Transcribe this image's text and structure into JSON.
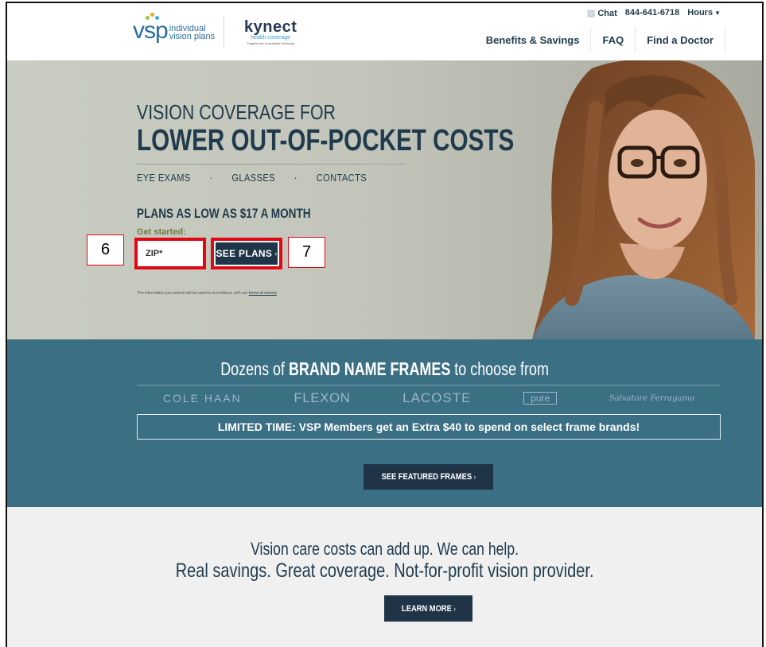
{
  "header": {
    "logo_vsp_text": "vsp",
    "logo_vsp_line1": "individual",
    "logo_vsp_line2": "vision plans",
    "logo_kynect_main": "kynect",
    "logo_kynect_sub": "health coverage",
    "logo_kynect_tagline": "Together for a Healthier Kentucky",
    "util": {
      "chat_label": "Chat",
      "phone": "844-641-6718",
      "hours_label": "Hours"
    },
    "nav": [
      {
        "label": "Benefits & Savings"
      },
      {
        "label": "FAQ"
      },
      {
        "label": "Find a Doctor"
      }
    ]
  },
  "hero": {
    "title_line1": "VISION COVERAGE FOR",
    "title_line2": "LOWER OUT-OF-POCKET COSTS",
    "items": [
      "EYE EXAMS",
      "GLASSES",
      "CONTACTS"
    ],
    "separator": "·",
    "plans_text": "PLANS AS LOW AS $17 A MONTH",
    "get_started": "Get started:",
    "zip_placeholder": "ZIP*",
    "see_plans_label": "SEE PLANS",
    "terms_prefix": "The information you submit will be used in accordance with our ",
    "terms_link": "terms of service",
    "terms_suffix": "."
  },
  "annotations": {
    "badge_6": "6",
    "badge_7": "7",
    "highlight_color": "#e30613"
  },
  "brands": {
    "title_pre": "Dozens of ",
    "title_bold": "BRAND NAME FRAMES",
    "title_post": " to choose from",
    "list": [
      "COLE HAAN",
      "FLEXON",
      "LACOSTE",
      "pure",
      "Salvatore Ferragamo"
    ],
    "limited_text": "LIMITED TIME: VSP Members get an Extra $40 to spend on select frame brands!",
    "featured_label": "SEE FEATURED FRAMES",
    "band_color": "#3b6f84"
  },
  "savings": {
    "line1": "Vision care costs can add up. We can help.",
    "line2": "Real savings. Great coverage. Not-for-profit vision provider.",
    "learn_more_label": "LEARN MORE"
  },
  "icons": {
    "chat": "chat-bubble-icon",
    "hours_caret": "caret-down-icon",
    "button_chevron": "chevron-right-icon"
  }
}
